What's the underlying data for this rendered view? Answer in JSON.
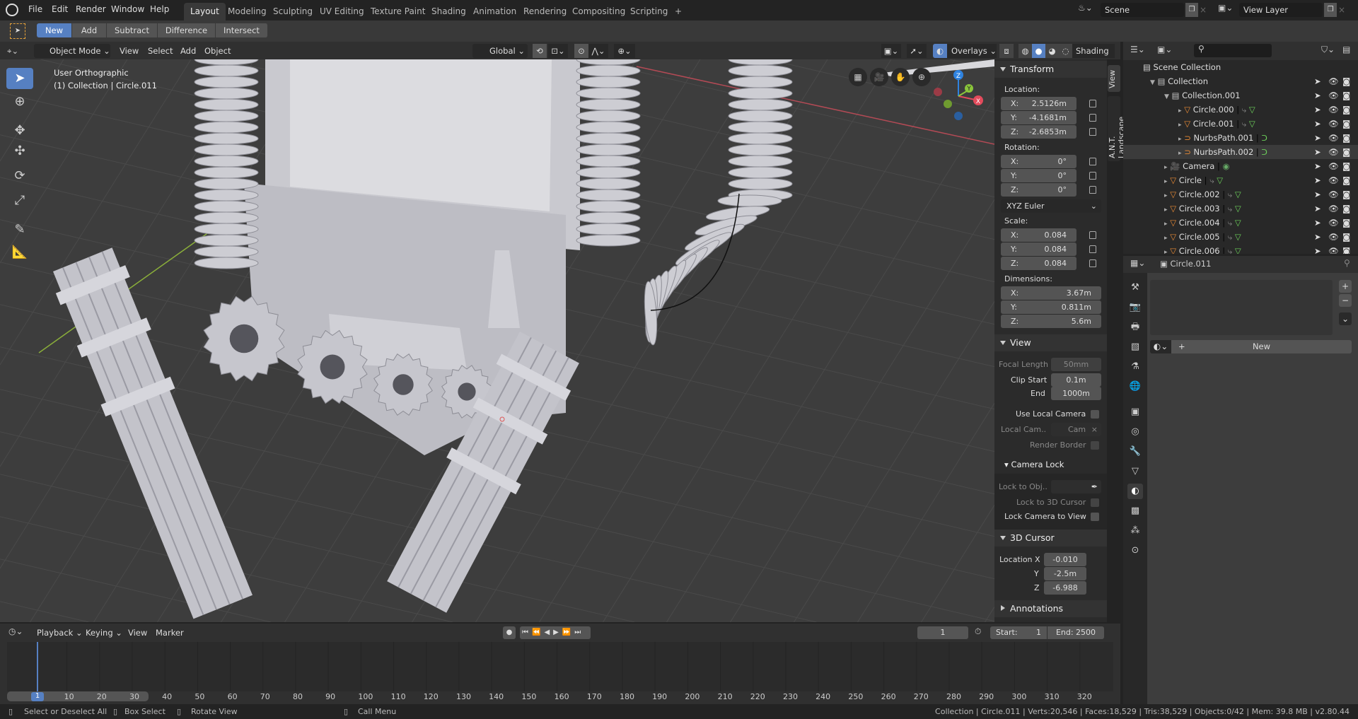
{
  "topbar": {
    "menus": [
      "File",
      "Edit",
      "Render",
      "Window",
      "Help"
    ],
    "workspaces": [
      "Layout",
      "Modeling",
      "Sculpting",
      "UV Editing",
      "Texture Paint",
      "Shading",
      "Animation",
      "Rendering",
      "Compositing",
      "Scripting"
    ],
    "active_workspace": "Layout",
    "add_tab": "+",
    "scene": "Scene",
    "view_layer": "View Layer"
  },
  "tool_header": {
    "modes": [
      "New",
      "Add",
      "Subtract",
      "Difference",
      "Intersect"
    ],
    "active": "New"
  },
  "viewport_header": {
    "mode": "Object Mode",
    "menus": [
      "View",
      "Select",
      "Add",
      "Object"
    ],
    "orientation": "Global",
    "overlays": "Overlays",
    "shading": "Shading"
  },
  "viewport": {
    "view_name": "User Orthographic",
    "collection_info": "(1) Collection | Circle.011",
    "gizmo": {
      "x": "X",
      "y": "Y",
      "z": "Z",
      "x_color": "#e34b5c",
      "y_color": "#8bc63b",
      "z_color": "#2f83e0"
    }
  },
  "npanel": {
    "tabs": [
      "View",
      "A.N.T. Landscape"
    ],
    "transform": {
      "title": "Transform",
      "location_label": "Location:",
      "location": {
        "x": "2.5126m",
        "y": "-4.1681m",
        "z": "-2.6853m"
      },
      "rotation_label": "Rotation:",
      "rotation": {
        "x": "0°",
        "y": "0°",
        "z": "0°"
      },
      "rotation_mode": "XYZ Euler",
      "scale_label": "Scale:",
      "scale": {
        "x": "0.084",
        "y": "0.084",
        "z": "0.084"
      },
      "dimensions_label": "Dimensions:",
      "dimensions": {
        "x": "3.67m",
        "y": "0.811m",
        "z": "5.6m"
      },
      "axis": {
        "x": "X:",
        "y": "Y:",
        "z": "Z:"
      }
    },
    "view": {
      "title": "View",
      "focal_length_label": "Focal Length",
      "focal_length": "50mm",
      "clip_start_label": "Clip Start",
      "clip_start": "0.1m",
      "end_label": "End",
      "clip_end": "1000m",
      "use_local_camera": "Use Local Camera",
      "local_camera_label": "Local Cam..",
      "local_camera": "Cam",
      "render_border": "Render Border",
      "camera_lock": "Camera Lock",
      "lock_to_obj": "Lock to Obj..",
      "lock_to_cursor": "Lock to 3D Cursor",
      "lock_camera_to_view": "Lock Camera to View"
    },
    "cursor": {
      "title": "3D Cursor",
      "location_x_label": "Location X",
      "y_label": "Y",
      "z_label": "Z",
      "x": "-0.010",
      "y": "-2.5m",
      "z": "-6.988"
    },
    "annotations": {
      "title": "Annotations"
    }
  },
  "outliner": {
    "scene_collection": "Scene Collection",
    "items": [
      {
        "name": "Collection",
        "type": "collection",
        "depth": 0
      },
      {
        "name": "Collection.001",
        "type": "collection",
        "depth": 1
      },
      {
        "name": "Circle.000",
        "type": "mesh",
        "depth": 2
      },
      {
        "name": "Circle.001",
        "type": "mesh",
        "depth": 2
      },
      {
        "name": "NurbsPath.001",
        "type": "curve",
        "depth": 2
      },
      {
        "name": "NurbsPath.002",
        "type": "curve",
        "depth": 2,
        "selected": true
      },
      {
        "name": "Camera",
        "type": "camera",
        "depth": 1
      },
      {
        "name": "Circle",
        "type": "mesh",
        "depth": 1
      },
      {
        "name": "Circle.002",
        "type": "mesh",
        "depth": 1
      },
      {
        "name": "Circle.003",
        "type": "mesh",
        "depth": 1
      },
      {
        "name": "Circle.004",
        "type": "mesh",
        "depth": 1
      },
      {
        "name": "Circle.005",
        "type": "mesh",
        "depth": 1
      },
      {
        "name": "Circle.006",
        "type": "mesh",
        "depth": 1
      }
    ]
  },
  "properties": {
    "object_name": "Circle.011",
    "new_button": "New",
    "active_tab": "material"
  },
  "timeline": {
    "menus": [
      "Playback",
      "Keying",
      "View",
      "Marker"
    ],
    "current_frame": "1",
    "start": "Start:",
    "start_value": "1",
    "end": "End: 2500",
    "ticks": [
      "10",
      "20",
      "30",
      "40",
      "50",
      "60",
      "70",
      "80",
      "90",
      "100",
      "110",
      "120",
      "130",
      "140",
      "150",
      "160",
      "170",
      "180",
      "190",
      "200",
      "210",
      "220",
      "230",
      "240",
      "250",
      "260",
      "270",
      "280",
      "290",
      "300",
      "310",
      "320"
    ]
  },
  "status": {
    "hints": [
      "Select or Deselect All",
      "Box Select",
      "Rotate View",
      "Call Menu"
    ],
    "info": "Collection | Circle.011 | Verts:20,546 | Faces:18,529 | Tris:38,529 | Objects:0/42 | Mem: 39.8 MB | v2.80.44"
  },
  "colors": {
    "accent": "#5680c2",
    "object_orange": "#e88a35",
    "mesh_data_green": "#6ccf5a",
    "modifier_blue": "#6fa6e0"
  }
}
